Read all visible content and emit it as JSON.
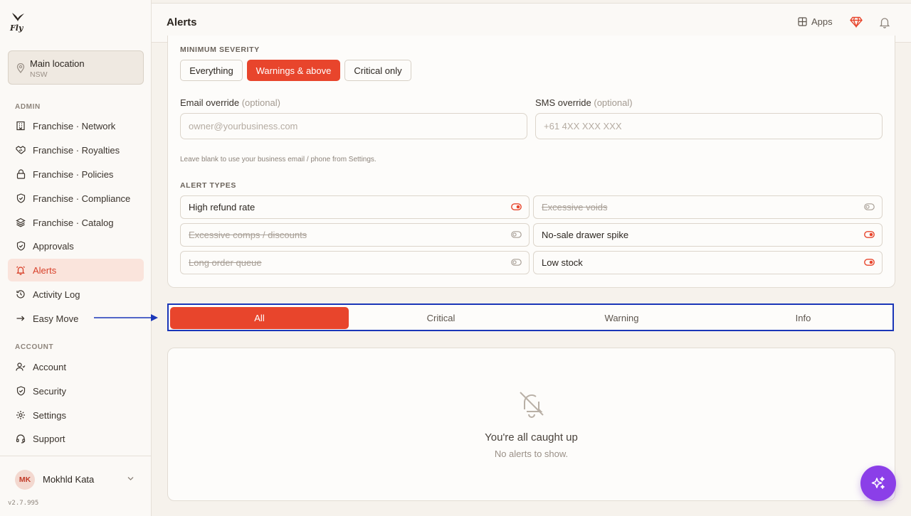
{
  "brand": {
    "logo_text": "Fly"
  },
  "location": {
    "name": "Main location",
    "region": "NSW"
  },
  "sidebar": {
    "admin_label": "ADMIN",
    "admin_items": [
      {
        "label": "Franchise · Network",
        "icon": "building-icon"
      },
      {
        "label": "Franchise · Royalties",
        "icon": "handshake-icon"
      },
      {
        "label": "Franchise · Policies",
        "icon": "lock-icon"
      },
      {
        "label": "Franchise · Compliance",
        "icon": "shield-check-icon"
      },
      {
        "label": "Franchise · Catalog",
        "icon": "layers-icon"
      },
      {
        "label": "Approvals",
        "icon": "shield-check-icon"
      },
      {
        "label": "Alerts",
        "icon": "bell-icon",
        "active": true
      },
      {
        "label": "Activity Log",
        "icon": "history-icon"
      },
      {
        "label": "Easy Move",
        "icon": "arrow-right-icon"
      }
    ],
    "account_label": "ACCOUNT",
    "account_items": [
      {
        "label": "Account",
        "icon": "user-icon"
      },
      {
        "label": "Security",
        "icon": "shield-icon"
      },
      {
        "label": "Settings",
        "icon": "gear-icon"
      },
      {
        "label": "Support",
        "icon": "headset-icon"
      }
    ]
  },
  "user": {
    "initials": "MK",
    "name": "Mokhld Kata"
  },
  "version": "v2.7.995",
  "header": {
    "title": "Alerts",
    "apps_label": "Apps"
  },
  "severity": {
    "label": "MINIMUM SEVERITY",
    "options": [
      "Everything",
      "Warnings & above",
      "Critical only"
    ],
    "selected": "Warnings & above"
  },
  "email_override": {
    "label": "Email override",
    "optional": "(optional)",
    "placeholder": "owner@yourbusiness.com",
    "value": ""
  },
  "sms_override": {
    "label": "SMS override",
    "optional": "(optional)",
    "placeholder": "+61 4XX XXX XXX",
    "value": ""
  },
  "override_hint": "Leave blank to use your business email / phone from Settings.",
  "alert_types": {
    "label": "ALERT TYPES",
    "items": [
      {
        "label": "High refund rate",
        "enabled": true
      },
      {
        "label": "Excessive voids",
        "enabled": false
      },
      {
        "label": "Excessive comps / discounts",
        "enabled": false
      },
      {
        "label": "No-sale drawer spike",
        "enabled": true
      },
      {
        "label": "Long order queue",
        "enabled": false
      },
      {
        "label": "Low stock",
        "enabled": true
      }
    ]
  },
  "filter_tabs": {
    "items": [
      "All",
      "Critical",
      "Warning",
      "Info"
    ],
    "selected": "All"
  },
  "empty_state": {
    "title": "You're all caught up",
    "subtitle": "No alerts to show."
  },
  "colors": {
    "accent": "#e8452c",
    "accent_soft": "#fae4dc",
    "fab": "#8b3fe8",
    "highlight_border": "#1a36b8"
  }
}
